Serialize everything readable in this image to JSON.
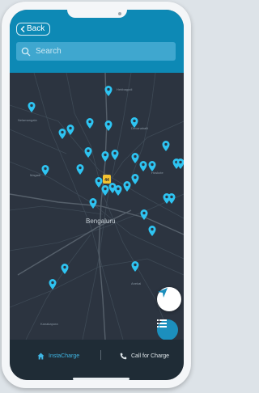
{
  "header": {
    "back_label": "Back",
    "search_placeholder": "Search"
  },
  "map": {
    "city_label": "Bengaluru",
    "highway_shield": "44",
    "labels": [
      {
        "id": "l1",
        "text": "Hebbagodi"
      },
      {
        "id": "l2",
        "text": "Nelamangala"
      },
      {
        "id": "l3",
        "text": "Devanahalli"
      },
      {
        "id": "l4",
        "text": "Magadi"
      },
      {
        "id": "l5",
        "text": "Hoskote"
      },
      {
        "id": "l6",
        "text": "Anekal"
      },
      {
        "id": "l7",
        "text": "Kanakapura"
      }
    ],
    "pin_color": "#2ec4f2",
    "shield_color": "#f2c230"
  },
  "controls": {
    "locate_icon": "navigation-arrow-icon",
    "list_icon": "list-icon"
  },
  "bottom_nav": {
    "tab_insta_charge": "InstaCharge",
    "tab_call_for_charge": "Call for Charge"
  },
  "colors": {
    "header": "#0d89b5",
    "search_bg": "#3fa7cf",
    "map_bg": "#2c3440",
    "bottom_bg": "#1f2c36",
    "active_tab": "#3fb6e4"
  }
}
